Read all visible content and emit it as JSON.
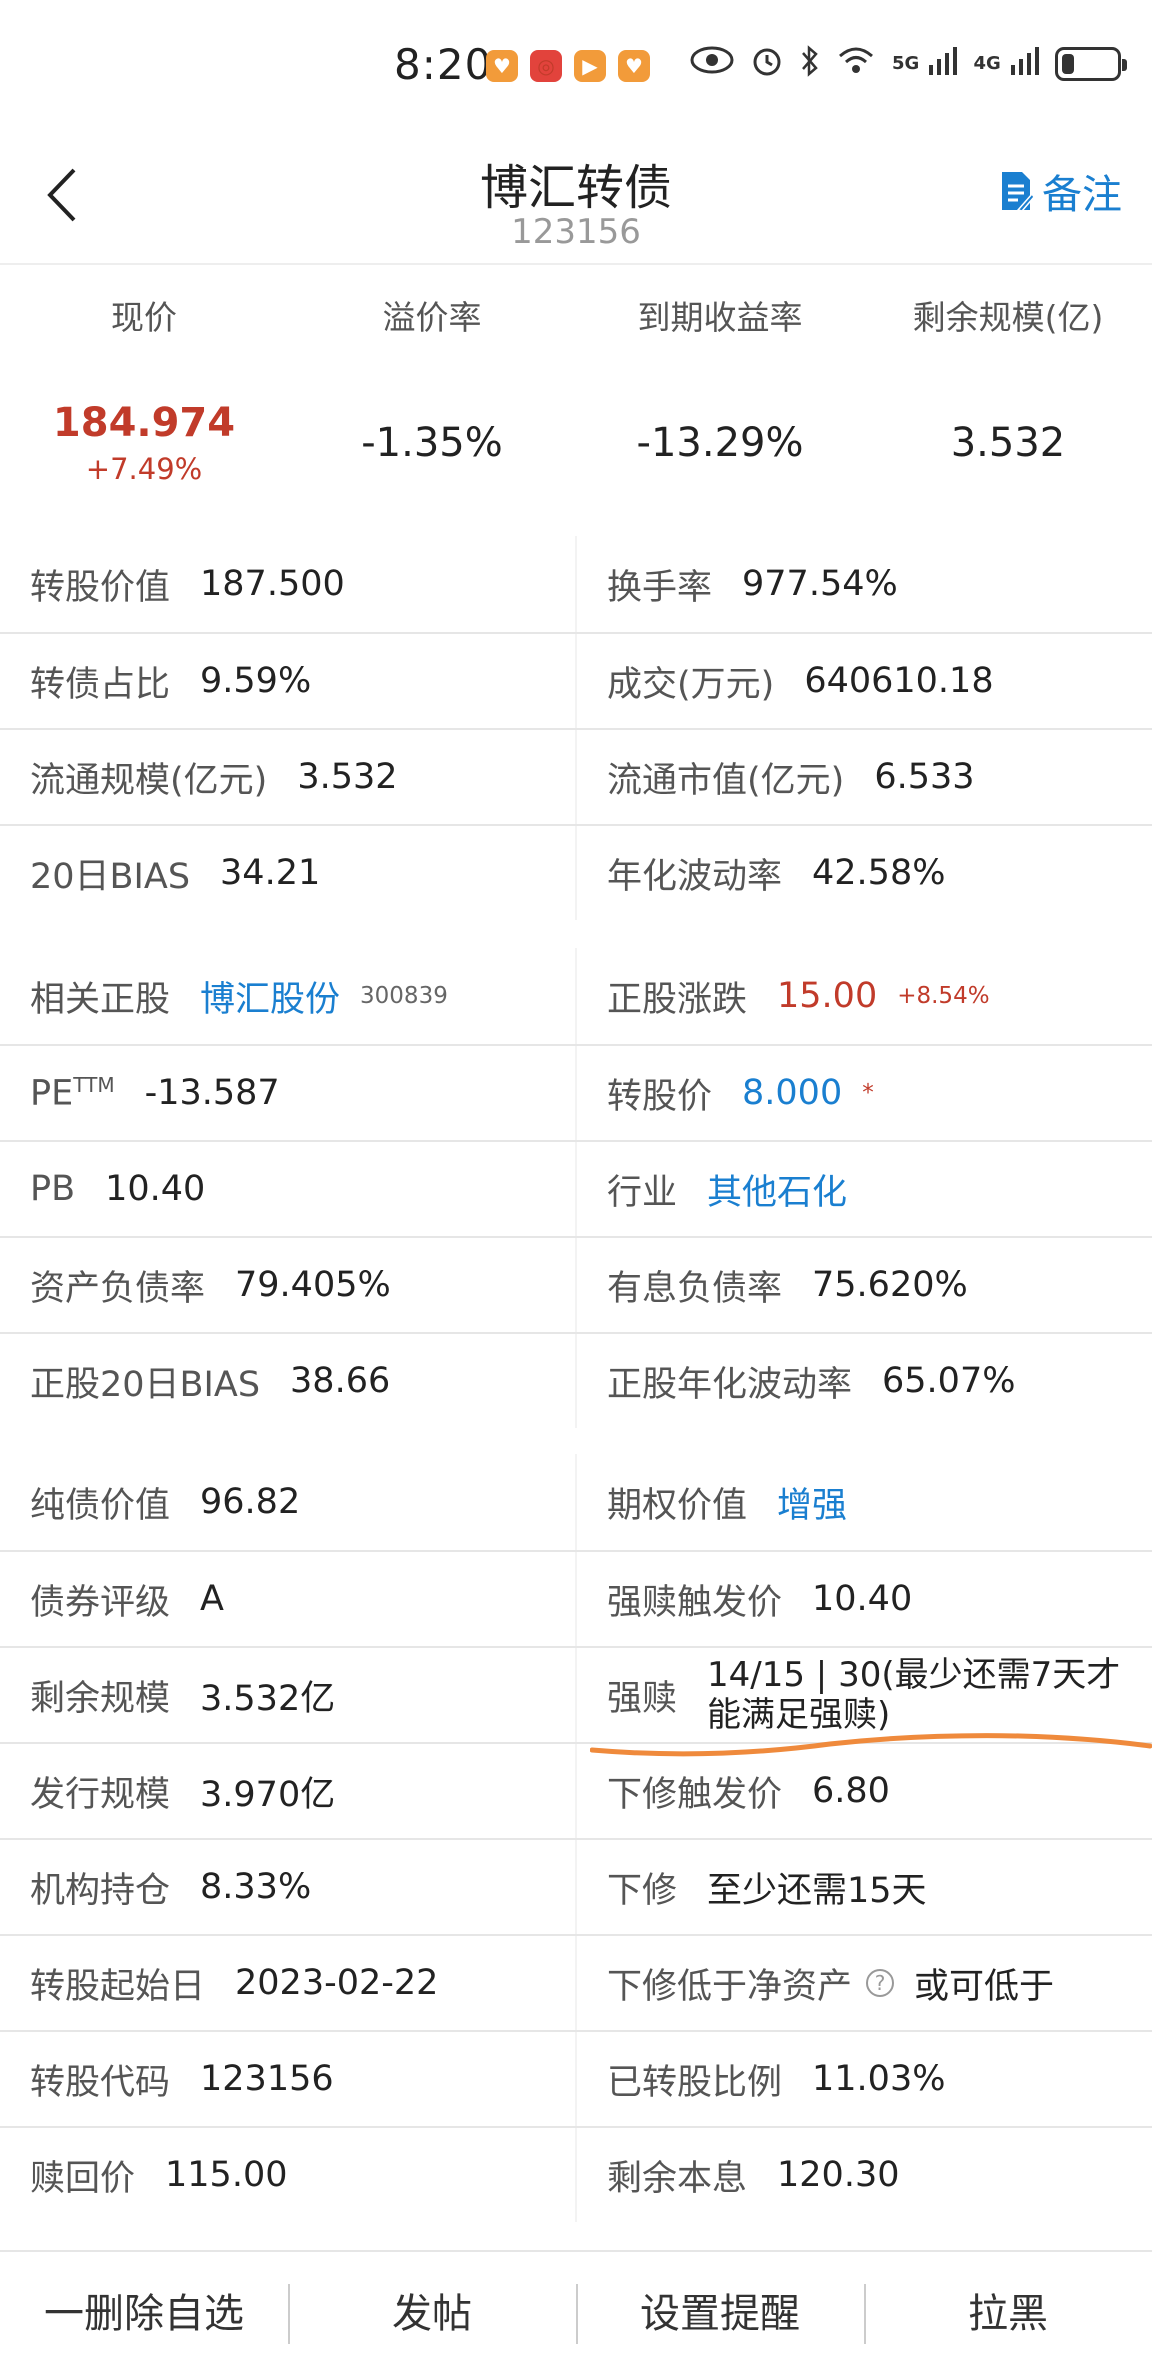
{
  "status_bar": {
    "time": "8:20",
    "app_icons": [
      "♥",
      "◎",
      "▶",
      "♥"
    ],
    "sig1": "5G",
    "sig2": "4G",
    "battery_level": 0.22
  },
  "header": {
    "title": "博汇转债",
    "code": "123156",
    "note_label": "备注"
  },
  "summary": {
    "headers": [
      "现价",
      "溢价率",
      "到期收益率",
      "剩余规模(亿)"
    ],
    "price": "184.974",
    "change": "+7.49%",
    "premium": "-1.35%",
    "ytm": "-13.29%",
    "remaining": "3.532"
  },
  "section1": [
    {
      "l1": "转股价值",
      "v1": "187.500",
      "l2": "换手率",
      "v2": "977.54%"
    },
    {
      "l1": "转债占比",
      "v1": "9.59%",
      "l2": "成交(万元)",
      "v2": "640610.18"
    },
    {
      "l1": "流通规模(亿元)",
      "v1": "3.532",
      "l2": "流通市值(亿元)",
      "v2": "6.533"
    },
    {
      "l1": "20日BIAS",
      "v1": "34.21",
      "l2": "年化波动率",
      "v2": "42.58%"
    }
  ],
  "section2": {
    "stock_label": "相关正股",
    "stock_name": "博汇股份",
    "stock_code": "300839",
    "stock_change_label": "正股涨跌",
    "stock_price": "15.00",
    "stock_pct": "+8.54%",
    "pe_label": "PE",
    "pe_sup": "TTM",
    "pe_value": "-13.587",
    "conv_price_label": "转股价",
    "conv_price": "8.000",
    "conv_mark": "*",
    "pb_label": "PB",
    "pb_value": "10.40",
    "industry_label": "行业",
    "industry_value": "其他石化",
    "debt_ratio_label": "资产负债率",
    "debt_ratio": "79.405%",
    "int_debt_label": "有息负债率",
    "int_debt": "75.620%",
    "stock_bias_label": "正股20日BIAS",
    "stock_bias": "38.66",
    "stock_vol_label": "正股年化波动率",
    "stock_vol": "65.07%"
  },
  "section3": {
    "bond_value_label": "纯债价值",
    "bond_value": "96.82",
    "option_label": "期权价值",
    "option_value": "增强",
    "rating_label": "债券评级",
    "rating": "A",
    "redeem_trigger_label": "强赎触发价",
    "redeem_trigger": "10.40",
    "remain_scale_label": "剩余规模",
    "remain_scale": "3.532亿",
    "redeem_label": "强赎",
    "redeem_value": "14/15 | 30(最少还需7天才能满足强赎)",
    "issue_label": "发行规模",
    "issue_value": "3.970亿",
    "reset_trigger_label": "下修触发价",
    "reset_trigger": "6.80",
    "inst_label": "机构持仓",
    "inst_value": "8.33%",
    "reset_label": "下修",
    "reset_value": "至少还需15天",
    "start_label": "转股起始日",
    "start_value": "2023-02-22",
    "below_nav_label": "下修低于净资产",
    "below_nav_value": "或可低于",
    "conv_code_label": "转股代码",
    "conv_code": "123156",
    "converted_label": "已转股比例",
    "converted": "11.03%",
    "redeem_price_label": "赎回价",
    "redeem_price": "115.00",
    "remain_interest_label": "剩余本息",
    "remain_interest": "120.30"
  },
  "bottom_bar": {
    "items": [
      "一删除自选",
      "发帖",
      "设置提醒",
      "拉黑"
    ]
  }
}
